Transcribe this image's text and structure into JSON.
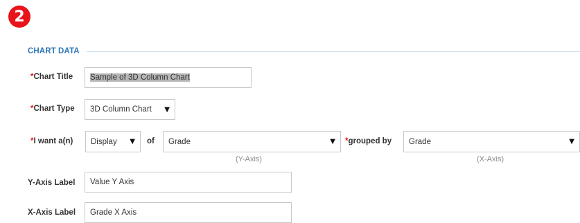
{
  "step_number": "2",
  "section": {
    "title": "CHART DATA"
  },
  "chart_title": {
    "required_mark": "*",
    "label": "Chart Title",
    "value": "Sample of 3D Column Chart"
  },
  "chart_type": {
    "required_mark": "*",
    "label": "Chart Type",
    "selected": "3D Column Chart"
  },
  "i_want": {
    "required_mark": "*",
    "label": "I want a(n)",
    "display_selected": "Display",
    "of_word": "of",
    "field_selected": "Grade",
    "y_axis_hint": "(Y-Axis)",
    "grouped_required_mark": "*",
    "grouped_by_label": "grouped by",
    "grouped_selected": "Grade",
    "x_axis_hint": "(X-Axis)"
  },
  "y_axis_label": {
    "label": "Y-Axis Label",
    "value": "Value Y Axis"
  },
  "x_axis_label": {
    "label": "X-Axis Label",
    "value": "Grade X Axis"
  },
  "icons": {
    "dropdown": "triangle-down-icon"
  },
  "colors": {
    "accent": "#2e75b6",
    "required": "#e8141a",
    "badge": "#e8141a",
    "hint": "#8c8c8c",
    "border": "#c8c8c8"
  }
}
